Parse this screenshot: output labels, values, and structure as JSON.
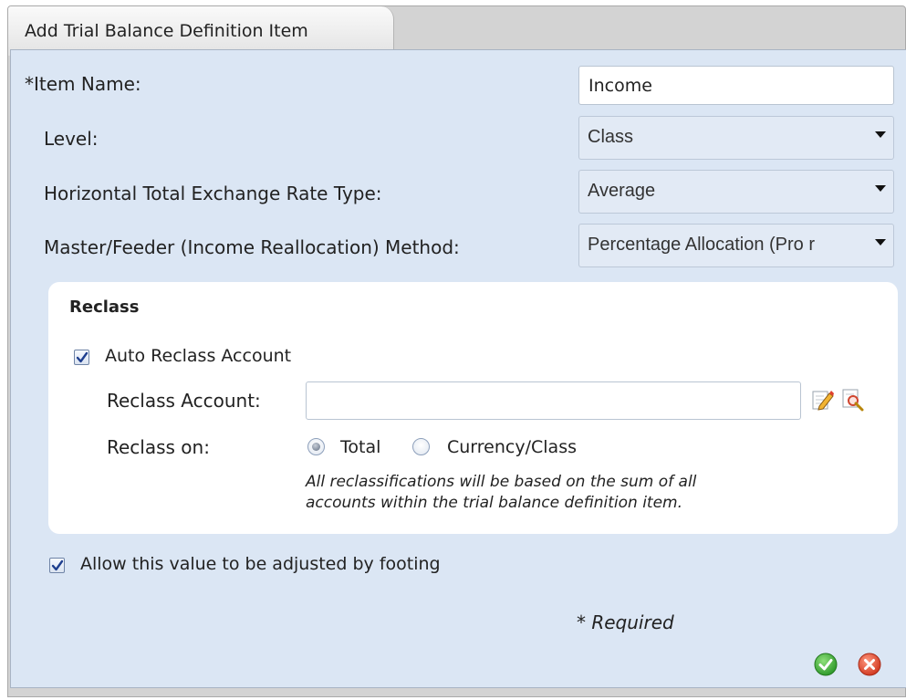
{
  "dialog": {
    "title": "Add Trial Balance Definition Item"
  },
  "form": {
    "item_name_label": "*Item Name:",
    "item_name_value": "Income",
    "level_label": "Level:",
    "level_value": "Class",
    "exchange_rate_label": "Horizontal Total Exchange Rate Type:",
    "exchange_rate_value": "Average",
    "method_label": "Master/Feeder (Income Reallocation) Method:",
    "method_value": "Percentage Allocation (Pro r"
  },
  "reclass": {
    "heading": "Reclass",
    "auto_reclass_label": "Auto Reclass Account",
    "auto_reclass_checked": true,
    "account_label": "Reclass Account:",
    "account_value": "",
    "reclass_on_label": "Reclass on:",
    "options": [
      "Total",
      "Currency/Class"
    ],
    "selected_option": "Total",
    "note_line1": "All reclassifications will be based on the sum of all",
    "note_line2": "accounts within the trial balance definition item."
  },
  "footing": {
    "label": "Allow this value to be adjusted by footing",
    "checked": true
  },
  "required_note": "* Required",
  "icons": {
    "edit": "edit-pencil-icon",
    "lookup": "lookup-search-icon",
    "ok": "ok-check-icon",
    "cancel": "cancel-x-icon"
  },
  "colors": {
    "body_bg": "#dbe6f4",
    "ok_green": "#3fae3a",
    "cancel_red": "#e0412f"
  }
}
